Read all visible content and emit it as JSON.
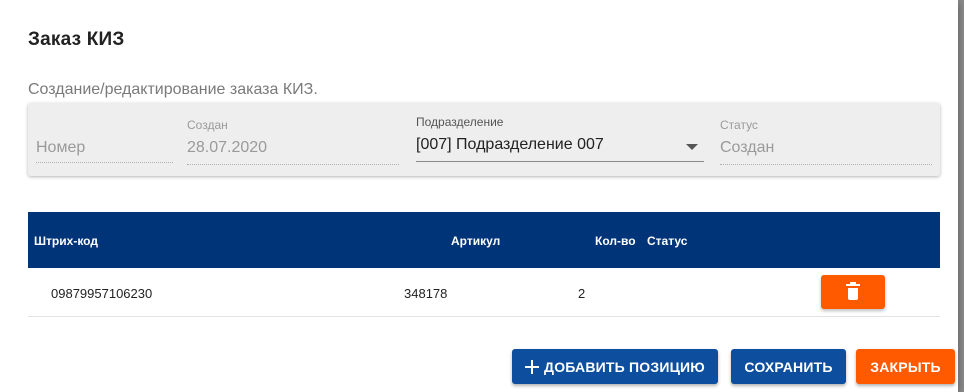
{
  "dialog": {
    "title": "Заказ КИЗ",
    "subtitle": "Создание/редактирование заказа КИЗ."
  },
  "form": {
    "number": {
      "placeholder": "Номер"
    },
    "created": {
      "label": "Создан",
      "value": "28.07.2020"
    },
    "division": {
      "label": "Подразделение",
      "value": "[007] Подразделение 007"
    },
    "status": {
      "label": "Статус",
      "value": "Создан"
    }
  },
  "table": {
    "columns": [
      "Штрих-код",
      "Артикул",
      "Кол-во",
      "Статус"
    ],
    "rows": [
      {
        "barcode": "09879957106230",
        "article": "348178",
        "qty": "2",
        "status": ""
      }
    ]
  },
  "actions": {
    "add_label": "ДОБАВИТЬ ПОЗИЦИЮ",
    "save_label": "СОХРАНИТЬ",
    "close_label": "ЗАКРЫТЬ"
  },
  "colors": {
    "header_bg": "#003478",
    "primary_button": "#0d4f9e",
    "accent_button": "#ff5a00"
  },
  "icons": {
    "delete": "trash-icon",
    "add": "plus-icon",
    "dropdown": "caret-down-icon"
  }
}
